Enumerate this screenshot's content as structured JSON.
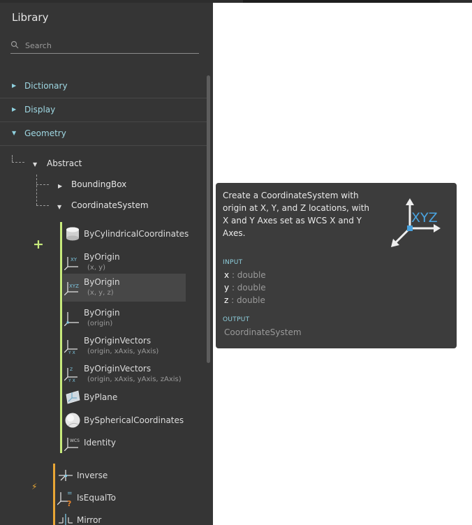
{
  "library": {
    "title": "Library",
    "search": {
      "placeholder": "Search",
      "value": ""
    },
    "categories": [
      {
        "label": "Dictionary",
        "expanded": false
      },
      {
        "label": "Display",
        "expanded": false
      },
      {
        "label": "Geometry",
        "expanded": true
      }
    ],
    "tree": {
      "abstract": "Abstract",
      "bounding_box": "BoundingBox",
      "coordinate_system": "CoordinateSystem"
    },
    "create_nodes": [
      {
        "name": "ByCylindricalCoordinates",
        "sub": "",
        "icon": "cylinder-icon"
      },
      {
        "name": "ByOrigin",
        "sub": "(x, y)",
        "icon": "xy-axes-icon"
      },
      {
        "name": "ByOrigin",
        "sub": "(x, y, z)",
        "icon": "xyz-axes-icon",
        "selected": true
      },
      {
        "name": "ByOrigin",
        "sub": "(origin)",
        "icon": "axes-icon"
      },
      {
        "name": "ByOriginVectors",
        "sub": "(origin, xAxis, yAxis)",
        "icon": "axes-vectors-icon"
      },
      {
        "name": "ByOriginVectors",
        "sub": "(origin, xAxis, yAxis, zAxis)",
        "icon": "axes-vectors-z-icon"
      },
      {
        "name": "ByPlane",
        "sub": "",
        "icon": "plane-icon"
      },
      {
        "name": "BySphericalCoordinates",
        "sub": "",
        "icon": "sphere-icon"
      },
      {
        "name": "Identity",
        "sub": "",
        "icon": "wcs-icon"
      }
    ],
    "action_nodes": [
      {
        "name": "Inverse",
        "icon": "inverse-icon"
      },
      {
        "name": "IsEqualTo",
        "icon": "is-equal-to-icon"
      },
      {
        "name": "Mirror",
        "icon": "mirror-icon"
      }
    ],
    "colors": {
      "create": "#c7ea7c",
      "action": "#e8a635",
      "accent": "#8fd1df"
    }
  },
  "tooltip": {
    "description": "Create a CoordinateSystem with origin at X, Y, and Z locations, with X and Y Axes set as WCS X and Y Axes.",
    "input_header": "INPUT",
    "inputs": [
      {
        "name": "x",
        "type": ": double"
      },
      {
        "name": "y",
        "type": ": double"
      },
      {
        "name": "z",
        "type": ": double"
      }
    ],
    "output_header": "OUTPUT",
    "output": "CoordinateSystem",
    "icon_text": "XYZ"
  }
}
